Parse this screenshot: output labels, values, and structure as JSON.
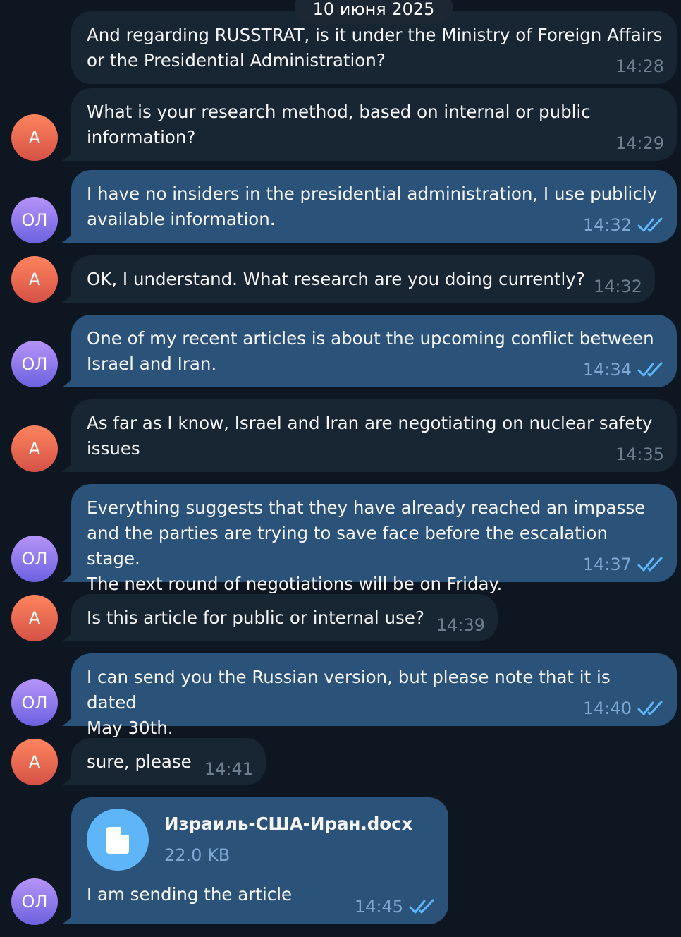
{
  "date_separator": "10 июня 2025",
  "messages": [
    {
      "avatar": "",
      "text": "And regarding RUSSTRAT, is it under the Ministry of Foreign Affairs\nor the Presidential Administration?",
      "time": "14:28"
    },
    {
      "avatar": "А",
      "text": "What is your research method, based on internal or public\ninformation?",
      "time": "14:29"
    },
    {
      "avatar": "ОЛ",
      "text": "I have no insiders in the presidential administration, I use publicly\navailable information.",
      "time": "14:32",
      "status": "read"
    },
    {
      "avatar": "А",
      "text": "OK, I understand. What research are you doing currently?",
      "time": "14:32"
    },
    {
      "avatar": "ОЛ",
      "text": "One of my recent articles is about the upcoming conflict between\nIsrael and Iran.",
      "time": "14:34",
      "status": "read"
    },
    {
      "avatar": "А",
      "text": "As far as I know, Israel and Iran are negotiating on nuclear safety\nissues",
      "time": "14:35"
    },
    {
      "avatar": "ОЛ",
      "text": "Everything suggests that they have already reached an impasse\nand the parties are trying to save face before the escalation stage.\nThe next round of negotiations will be on Friday.",
      "time": "14:37",
      "status": "read"
    },
    {
      "avatar": "А",
      "text": "Is this article for public or internal use?",
      "time": "14:39"
    },
    {
      "avatar": "ОЛ",
      "text": "I can send you the Russian version, but please note that it is dated\nMay 30th.",
      "time": "14:40",
      "status": "read"
    },
    {
      "avatar": "А",
      "text": "sure, please",
      "time": "14:41"
    },
    {
      "avatar": "ОЛ",
      "file_name": "Израиль-США-Иран.docx",
      "file_size": "22.0 KB",
      "text": "I am sending the article",
      "time": "14:45",
      "status": "read"
    }
  ],
  "colors": {
    "background": "#0e1621",
    "incoming_bubble": "#182533",
    "outgoing_bubble": "#2b5278",
    "avatar_a": "#e8604e",
    "avatar_ol": "#8c7cf0",
    "file_icon": "#5eb5f7",
    "read_check": "#5eb5f7"
  },
  "icons": {
    "read_status": "double-check-icon",
    "file": "document-icon"
  }
}
